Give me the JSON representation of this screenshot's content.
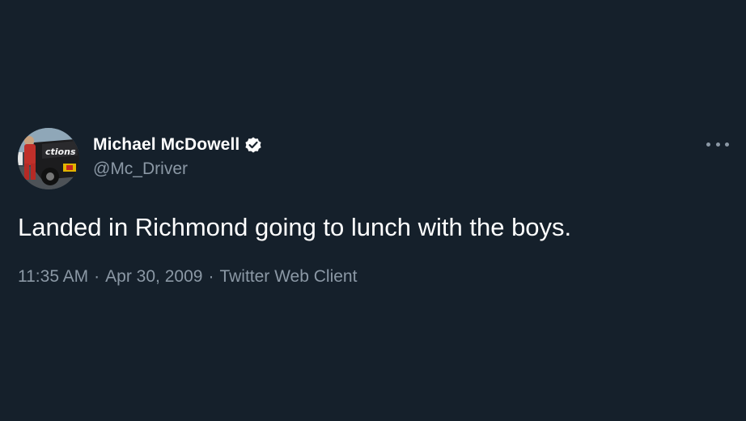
{
  "colors": {
    "background": "#15202b",
    "primary_text": "#ffffff",
    "secondary_text": "#8b98a5",
    "verified_badge": "#ffffff"
  },
  "tweet": {
    "author": {
      "display_name": "Michael McDowell",
      "handle": "@Mc_Driver",
      "verified": true,
      "avatar": {
        "icon": "race-car-driver-photo",
        "lettering": "actions"
      }
    },
    "more_menu_icon": "more-dots-icon",
    "text": "Landed in Richmond going to lunch with the boys.",
    "meta": {
      "time": "11:35 AM",
      "date": "Apr 30, 2009",
      "source": "Twitter Web Client",
      "separator": "·"
    }
  }
}
